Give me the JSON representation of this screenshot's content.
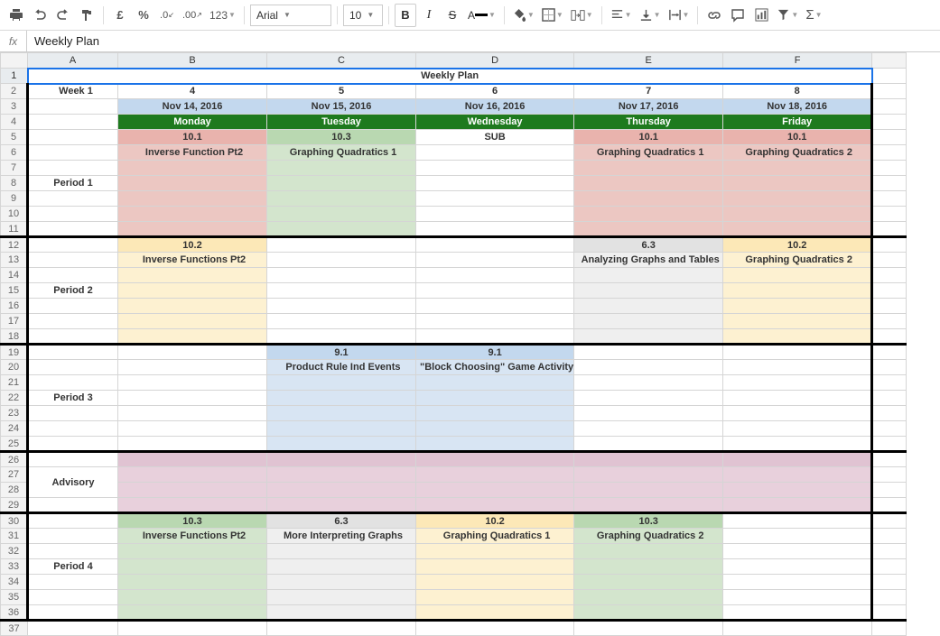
{
  "toolbar": {
    "font": "Arial",
    "font_size": "10",
    "currency_symbol": "£"
  },
  "formula_bar": {
    "fx": "fx",
    "value": "Weekly Plan"
  },
  "columns": [
    "A",
    "B",
    "C",
    "D",
    "E",
    "F"
  ],
  "row_numbers": [
    "1",
    "2",
    "3",
    "4",
    "5",
    "6",
    "7",
    "8",
    "9",
    "10",
    "11",
    "12",
    "13",
    "14",
    "15",
    "16",
    "17",
    "18",
    "19",
    "20",
    "21",
    "22",
    "23",
    "24",
    "25",
    "26",
    "27",
    "28",
    "29",
    "30",
    "31",
    "32",
    "33",
    "34",
    "35",
    "36",
    "37"
  ],
  "title": "Weekly Plan",
  "week": {
    "label": "Week 1",
    "nums": [
      "4",
      "5",
      "6",
      "7",
      "8"
    ]
  },
  "dates": [
    "Nov 14, 2016",
    "Nov 15, 2016",
    "Nov 16, 2016",
    "Nov 17, 2016",
    "Nov 18, 2016"
  ],
  "days": [
    "Monday",
    "Tuesday",
    "Wednesday",
    "Thursday",
    "Friday"
  ],
  "periods": {
    "p1": {
      "label": "Period 1",
      "section": [
        "10.1",
        "10.3",
        "SUB",
        "10.1",
        "10.1"
      ],
      "lesson": [
        "Inverse Function Pt2",
        "Graphing Quadratics 1",
        "",
        "Graphing Quadratics 1",
        "Graphing Quadratics 2"
      ]
    },
    "p2": {
      "label": "Period 2",
      "section": [
        "10.2",
        "",
        "",
        "6.3",
        "10.2"
      ],
      "lesson": [
        "Inverse Functions Pt2",
        "",
        "",
        "Analyzing Graphs and Tables",
        "Graphing Quadratics 2"
      ]
    },
    "p3": {
      "label": "Period 3",
      "section": [
        "",
        "9.1",
        "9.1",
        "",
        ""
      ],
      "lesson": [
        "",
        "Product Rule Ind Events",
        "\"Block Choosing\" Game Activity",
        "",
        ""
      ]
    },
    "advisory": {
      "label": "Advisory"
    },
    "p4": {
      "label": "Period 4",
      "section": [
        "10.3",
        "6.3",
        "10.2",
        "10.3",
        ""
      ],
      "lesson": [
        "Inverse Functions Pt2",
        "More Interpreting Graphs",
        "Graphing Quadratics 1",
        "Graphing Quadratics 2",
        ""
      ]
    }
  }
}
